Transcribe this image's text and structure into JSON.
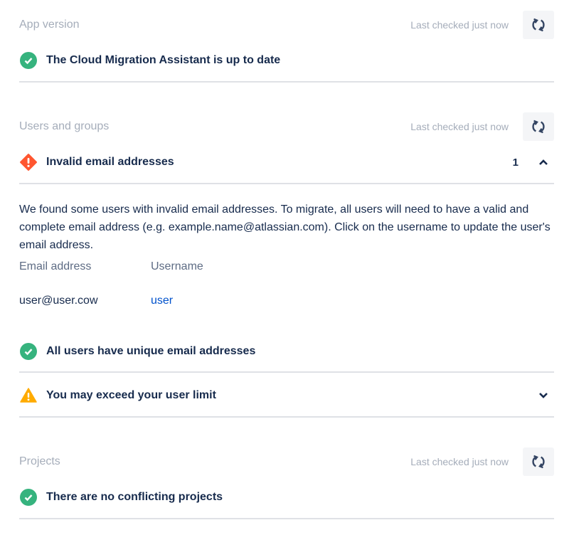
{
  "sections": {
    "app_version": {
      "title": "App version",
      "last_checked": "Last checked just now",
      "checks": [
        {
          "status": "success",
          "icon": "check-circle-icon",
          "label": "The Cloud Migration Assistant is up to date"
        }
      ]
    },
    "users_groups": {
      "title": "Users and groups",
      "last_checked": "Last checked just now",
      "checks": [
        {
          "status": "error",
          "icon": "error-diamond-icon",
          "label": "Invalid email addresses",
          "count": "1",
          "expanded": true,
          "description": "We found some users with invalid email addresses. To migrate, all users will need to have a valid and complete email address (e.g. example.name@atlassian.com). Click on the username to update the user's email address.",
          "table": {
            "columns": [
              "Email address",
              "Username"
            ],
            "rows": [
              {
                "email": "user@user.cow",
                "username": "user"
              }
            ]
          }
        },
        {
          "status": "success",
          "icon": "check-circle-icon",
          "label": "All users have unique email addresses"
        },
        {
          "status": "warning",
          "icon": "warning-triangle-icon",
          "label": "You may exceed your user limit",
          "expanded": false
        }
      ]
    },
    "projects": {
      "title": "Projects",
      "last_checked": "Last checked just now",
      "checks": [
        {
          "status": "success",
          "icon": "check-circle-icon",
          "label": "There are no conflicting projects"
        }
      ]
    }
  },
  "colors": {
    "success": "#36b37e",
    "error": "#ff5630",
    "warning": "#ffab00",
    "link": "#0052cc",
    "muted": "#a5adba",
    "text": "#172b4d"
  }
}
